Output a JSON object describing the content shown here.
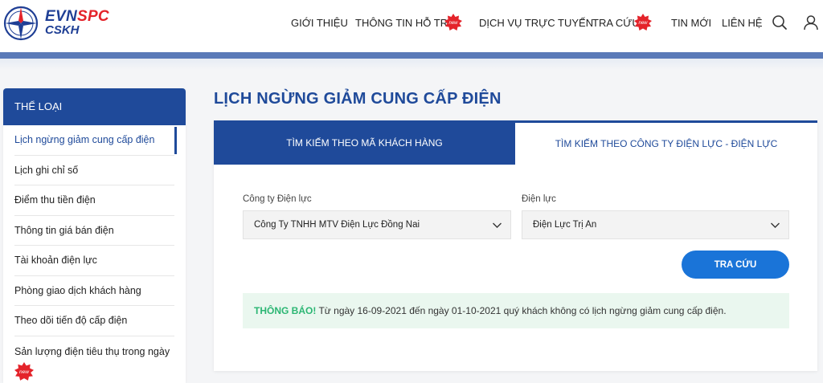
{
  "brand": {
    "line1_a": "EVN",
    "line1_b": "SPC",
    "line2": "CSKH"
  },
  "nav": {
    "items": [
      "GIỚI THIỆU",
      "THÔNG TIN HỖ TRỢ",
      "DỊCH VỤ TRỰC TUYẾN",
      "TRA CỨU",
      "TIN MỚI",
      "LIÊN HỆ"
    ],
    "badge_text": "new",
    "icons": [
      "search-icon",
      "user-icon"
    ]
  },
  "sidebar": {
    "title": "THỂ LOẠI",
    "items": [
      "Lịch ngừng giảm cung cấp điện",
      "Lịch ghi chỉ số",
      "Điểm thu tiền điện",
      "Thông tin giá bán điện",
      "Tài khoản điện lực",
      "Phòng giao dịch khách hàng",
      "Theo dõi tiến độ cấp điện",
      "Sản lượng điện tiêu thụ trong ngày"
    ],
    "active_index": 0
  },
  "main": {
    "title": "LỊCH NGỪNG GIẢM CUNG CẤP ĐIỆN",
    "tabs": [
      "TÌM KIẾM THEO MÃ KHÁCH HÀNG",
      "TÌM KIẾM THEO CÔNG TY ĐIỆN LỰC - ĐIỆN LỰC"
    ],
    "company_label": "Công ty Điện lực",
    "company_value": "Công Ty TNHH MTV Điện Lực Đồng Nai",
    "unit_label": "Điện lực",
    "unit_value": "Điện Lực Trị An",
    "search_button": "TRA CỨU",
    "notice_tag": "THÔNG BÁO!",
    "notice_text": " Từ ngày 16-09-2021 đến ngày 01-10-2021 quý khách không có lịch ngừng giảm cung cấp điện."
  },
  "colors": {
    "primary": "#1f4a9a",
    "button": "#1a74d8",
    "notice_bg": "#eaf7ef",
    "notice_tag": "#2bb673",
    "badge": "#e4232a"
  }
}
